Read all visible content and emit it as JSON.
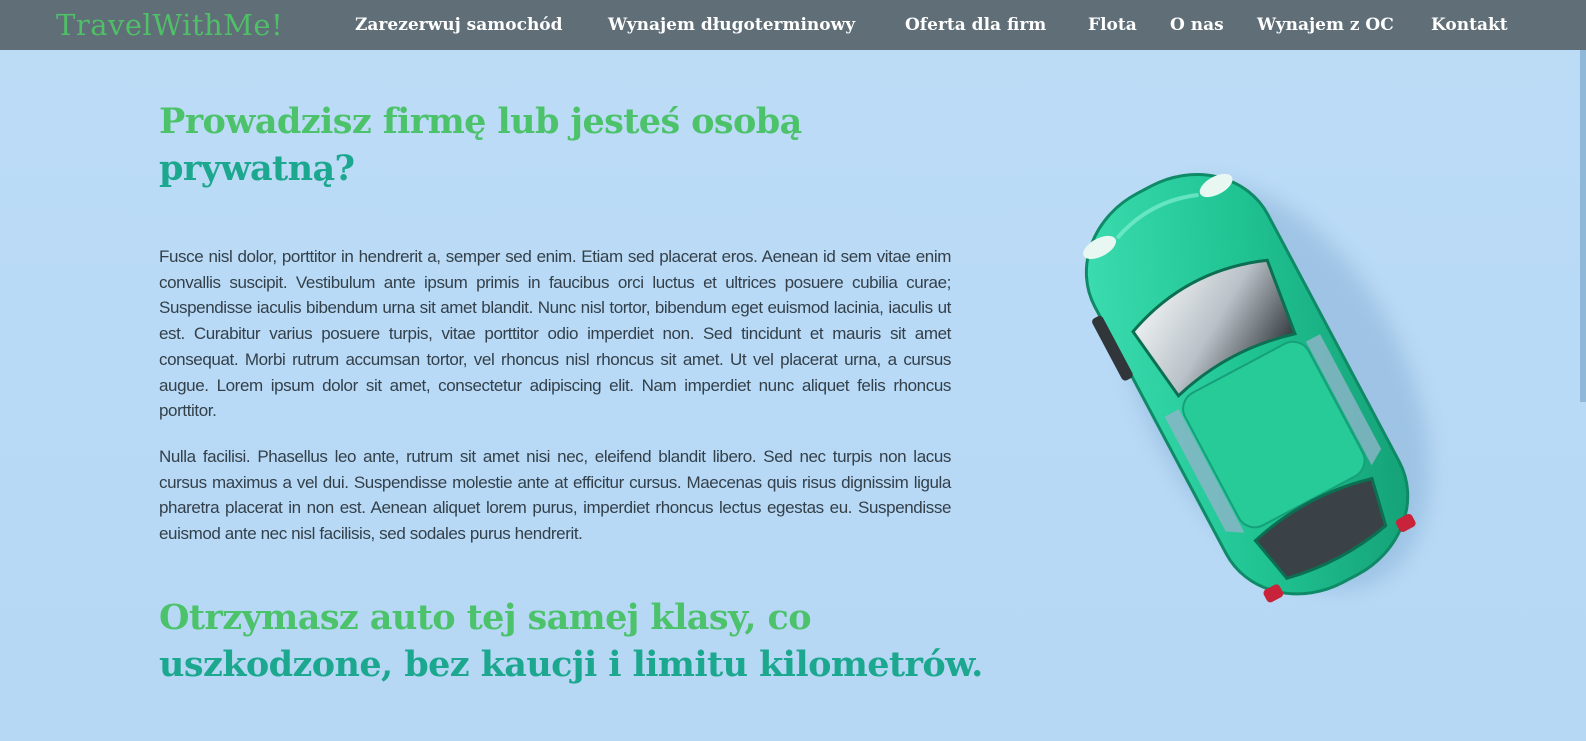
{
  "brand": "TravelWithMe!",
  "nav": [
    {
      "label": "Zarezerwuj samochód"
    },
    {
      "label": "Wynajem długoterminowy"
    },
    {
      "label": "Oferta dla firm"
    },
    {
      "label": "Flota"
    },
    {
      "label": "O nas"
    },
    {
      "label": "Wynajem z OC"
    },
    {
      "label": "Kontakt"
    }
  ],
  "hero": {
    "heading_line1": "Prowadzisz firmę lub jesteś osobą",
    "heading_line2": "prywatną?",
    "paragraphs": [
      "Fusce nisl dolor, porttitor in hendrerit a, semper sed enim. Etiam sed placerat eros. Aenean id sem vitae enim convallis suscipit. Vestibulum ante ipsum primis in faucibus orci luctus et ultrices posuere cubilia curae; Suspendisse iaculis bibendum urna sit amet blandit. Nunc nisl tortor, bibendum eget euismod lacinia, iaculis ut est. Curabitur varius posuere turpis, vitae porttitor odio imperdiet non. Sed tincidunt et mauris sit amet consequat. Morbi rutrum accumsan tortor, vel rhoncus nisl rhoncus sit amet. Ut vel placerat urna, a cursus augue. Lorem ipsum dolor sit amet, consectetur adipiscing elit. Nam imperdiet nunc aliquet felis rhoncus porttitor.",
      "Nulla facilisi. Phasellus leo ante, rutrum sit amet nisi nec, eleifend blandit libero. Sed nec turpis non lacus cursus maximus a vel dui. Suspendisse molestie ante at efficitur cursus. Maecenas quis risus dignissim ligula pharetra placerat in non est. Aenean aliquet lorem purus, imperdiet rhoncus lectus egestas eu. Suspendisse euismod ante nec nisl facilisis, sed sodales purus hendrerit."
    ],
    "subheading_line1": "Otrzymasz auto tej samej klasy, co",
    "subheading_line2": "uszkodzone, bez kaucji i limitu kilometrów."
  },
  "colors": {
    "nav_bg": "#5f6e77",
    "brand": "#4fbf68",
    "heading_green": "#4cc26b",
    "heading_teal": "#1ca78f",
    "background": "#bcdcf6",
    "car": "#22c495"
  },
  "icons": {
    "car_image": "toy-car-image"
  }
}
